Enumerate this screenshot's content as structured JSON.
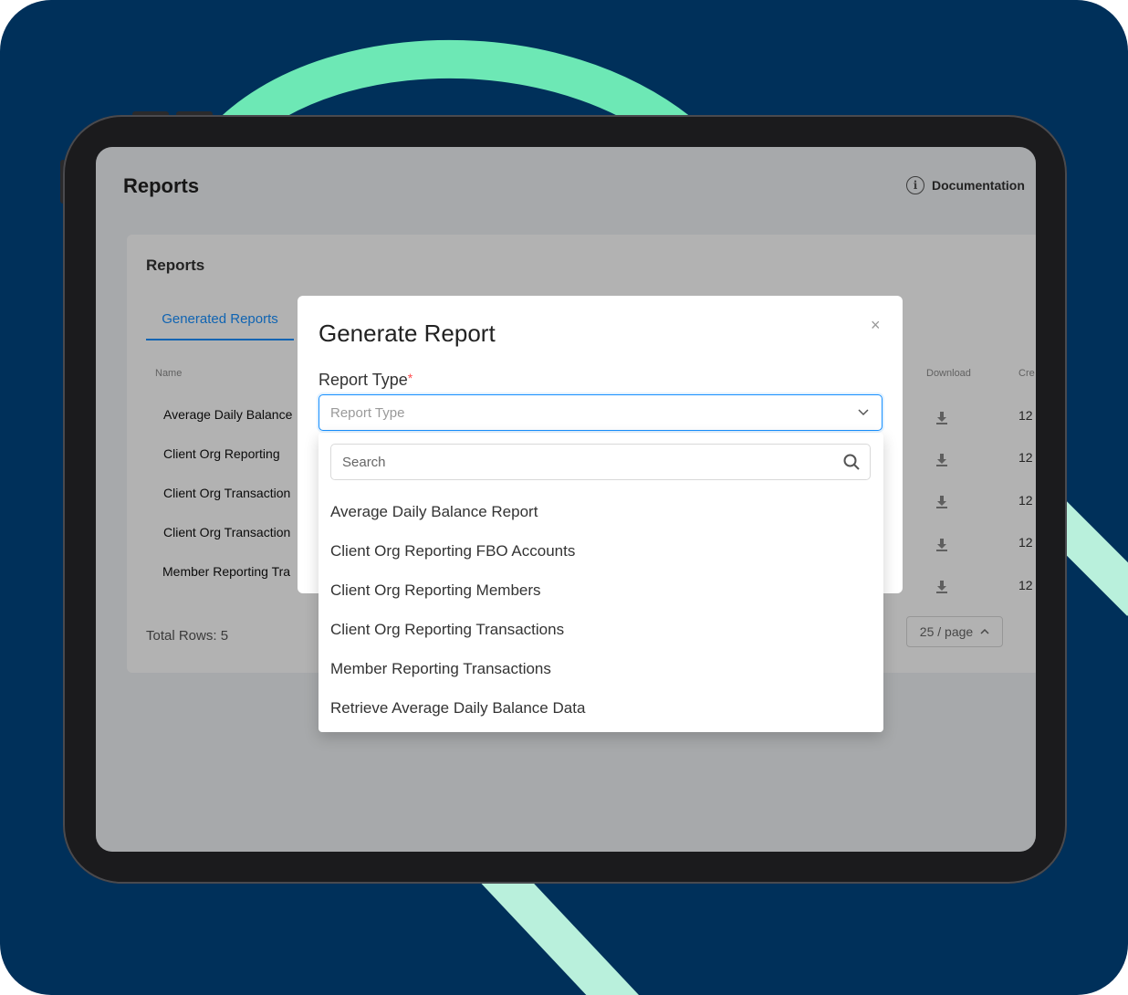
{
  "page": {
    "title": "Reports",
    "doc_link": "Documentation"
  },
  "card": {
    "title": "Reports",
    "tab": "Generated Reports",
    "columns": {
      "name": "Name",
      "download": "Download",
      "created": "Cre"
    },
    "rows": [
      {
        "name": "Average Daily Balance",
        "created": "12"
      },
      {
        "name": "Client Org Reporting",
        "created": "12"
      },
      {
        "name": "Client Org Transaction",
        "created": "12"
      },
      {
        "name": "Client Org Transaction",
        "created": "12"
      },
      {
        "name": "Member Reporting Tra",
        "created": "12"
      }
    ],
    "total_rows": "Total Rows: 5",
    "page_size": "25 / page"
  },
  "modal": {
    "title": "Generate Report",
    "close_icon": "×",
    "field_label": "Report Type",
    "required_mark": "*",
    "select_placeholder": "Report Type"
  },
  "dropdown": {
    "search_placeholder": "Search",
    "options": [
      "Average Daily Balance Report",
      "Client Org Reporting FBO Accounts",
      "Client Org Reporting Members",
      "Client Org Reporting Transactions",
      "Member Reporting Transactions",
      "Retrieve Average Daily Balance Data"
    ]
  },
  "colors": {
    "background": "#00305a",
    "accent_arc": "#6de8b5",
    "primary": "#1890ff",
    "required": "#ff4d4f"
  }
}
